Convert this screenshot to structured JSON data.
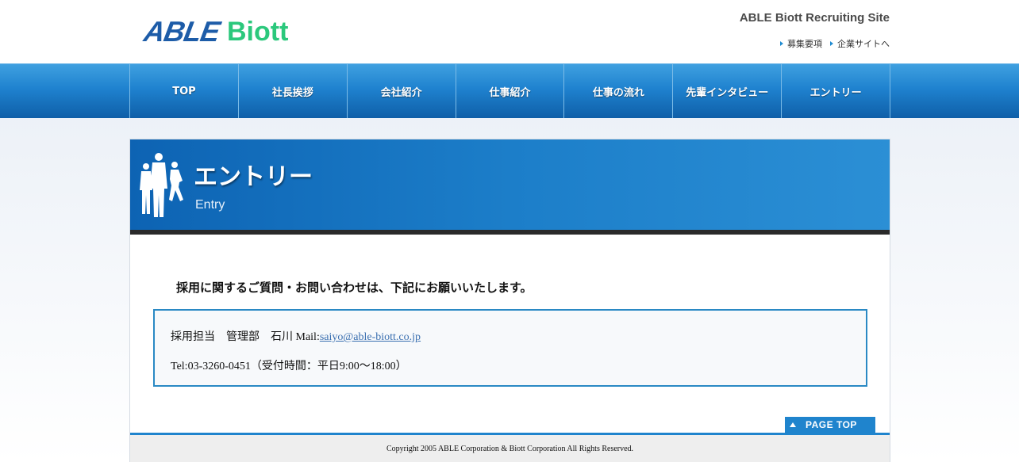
{
  "header": {
    "logo_able": "ABLE",
    "logo_biott": "Biott",
    "site_title": "ABLE Biott Recruiting Site",
    "links": [
      {
        "label": "募集要項"
      },
      {
        "label": "企業サイトへ"
      }
    ]
  },
  "nav": {
    "items": [
      {
        "label": "TOP"
      },
      {
        "label": "社長挨拶"
      },
      {
        "label": "会社紹介"
      },
      {
        "label": "仕事紹介"
      },
      {
        "label": "仕事の流れ"
      },
      {
        "label": "先輩インタビュー"
      },
      {
        "label": "エントリー"
      }
    ]
  },
  "banner": {
    "title": "エントリー",
    "subtitle": "Entry"
  },
  "main": {
    "intro": "採用に関するご質問・お問い合わせは、下記にお願いいたします。",
    "contact": {
      "line1_prefix": "採用担当　管理部　石川 Mail:",
      "email": "saiyo@able-biott.co.jp",
      "line2": "Tel:03-3260-0451（受付時間：平日9:00～18:00）"
    }
  },
  "footer": {
    "pagetop_label": "PAGE TOP",
    "copyright": "Copyright 2005 ABLE Corporation & Biott Corporation All Rights Reserved."
  },
  "colors": {
    "brand_blue": "#1f84cd",
    "logo_green": "#2bc87c",
    "logo_blue": "#1d5ca8"
  }
}
